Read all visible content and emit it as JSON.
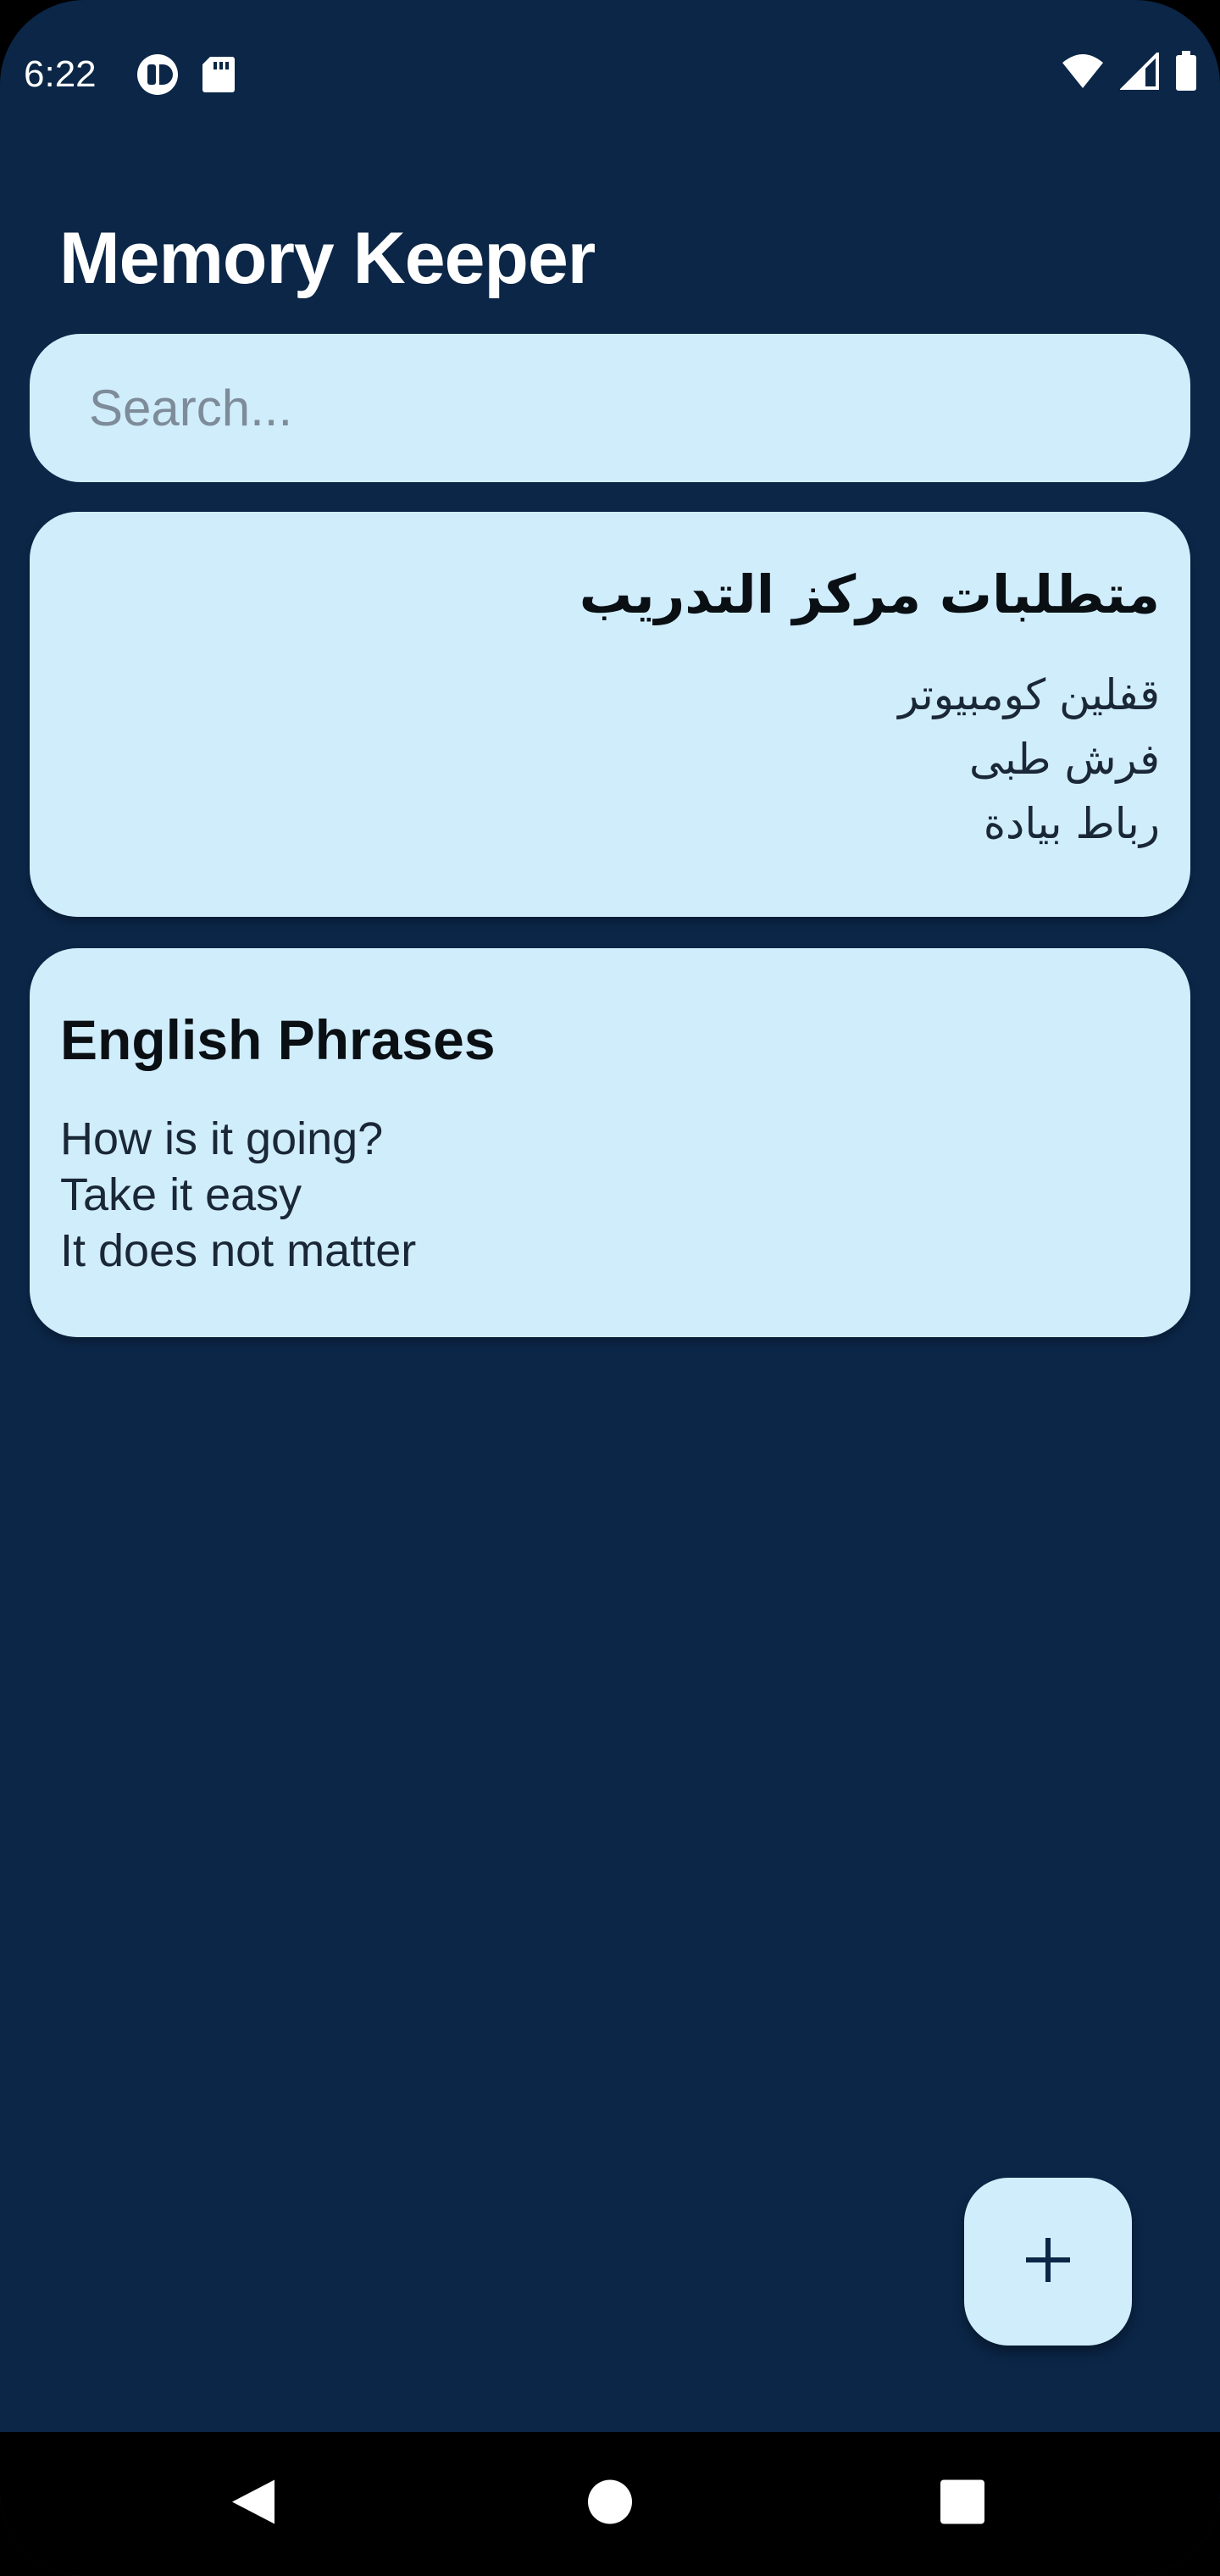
{
  "status_bar": {
    "time": "6:22",
    "left_icons": [
      "notification-app-icon",
      "sd-card-icon"
    ],
    "right_icons": [
      "wifi-icon",
      "cellular-signal-icon",
      "battery-icon"
    ]
  },
  "app": {
    "title": "Memory Keeper"
  },
  "search": {
    "placeholder": "Search...",
    "value": ""
  },
  "notes": [
    {
      "title": "متطلبات مركز التدريب",
      "body": "قفلين كومبيوتر\nفرش طبى\nرباط بيادة",
      "direction": "rtl"
    },
    {
      "title": "English Phrases",
      "body": "How is it going?\nTake it easy\nIt does not matter",
      "direction": "ltr"
    }
  ],
  "fab": {
    "icon": "plus-icon"
  },
  "nav_bar": {
    "buttons": [
      "back-icon",
      "home-icon",
      "recents-icon"
    ]
  },
  "colors": {
    "background": "#0b2647",
    "card": "#d0edfc",
    "title_text": "#ffffff",
    "nav_bar": "#000000"
  }
}
